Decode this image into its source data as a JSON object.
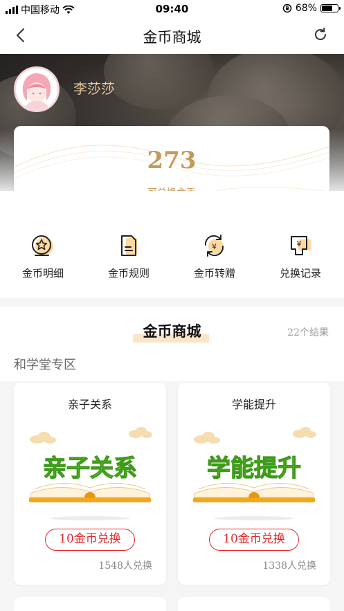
{
  "status_bar": {
    "carrier": "中国移动",
    "time": "09:40",
    "battery": "68%",
    "battery_level": 0.68
  },
  "nav": {
    "title": "金币商城"
  },
  "user": {
    "name": "李莎莎"
  },
  "balance": {
    "amount": "273",
    "label": "可兑换金币"
  },
  "quick_actions": [
    {
      "label": "金币明细",
      "icon": "coin-star-icon"
    },
    {
      "label": "金币规则",
      "icon": "document-icon"
    },
    {
      "label": "金币转赠",
      "icon": "yen-transfer-icon"
    },
    {
      "label": "兑换记录",
      "icon": "yen-receipt-icon"
    }
  ],
  "store": {
    "title": "金币商城",
    "result_count": "22个结果",
    "zone_title": "和学堂专区",
    "products": [
      {
        "title": "亲子关系",
        "art_text": "亲子关系",
        "button": "10金币兑换",
        "sold": "1548人兑换"
      },
      {
        "title": "学能提升",
        "art_text": "学能提升",
        "button": "10金币兑换",
        "sold": "1338人兑换"
      }
    ]
  },
  "colors": {
    "accent_gold": "#c49a5a",
    "button_red": "#e2262b",
    "art_green": "#7ed321"
  }
}
